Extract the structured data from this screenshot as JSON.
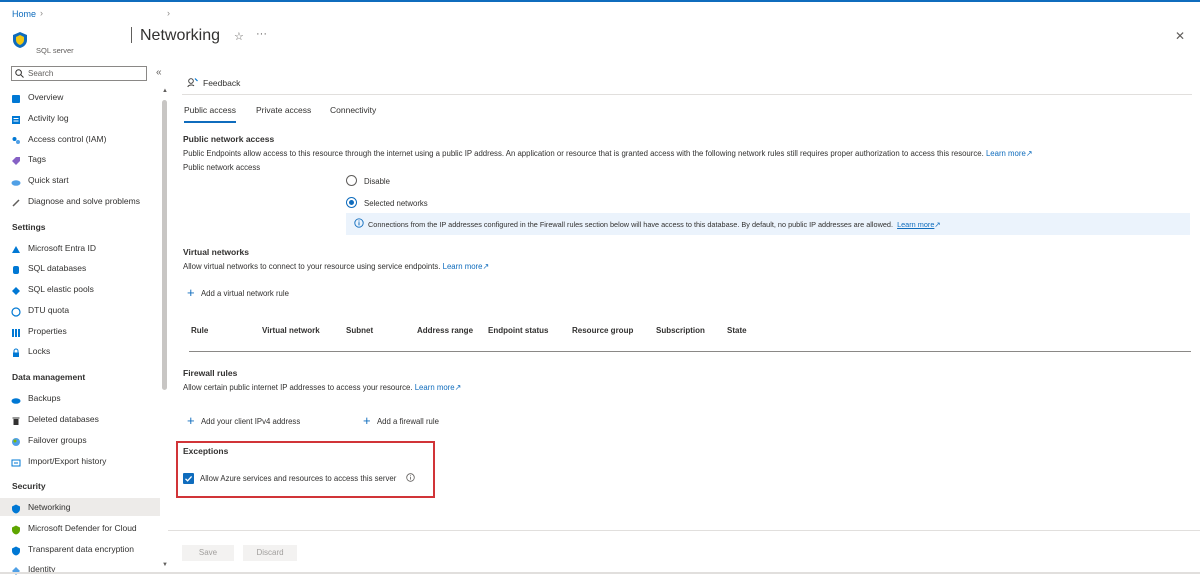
{
  "breadcrumb": {
    "home": "Home"
  },
  "header": {
    "title": "Networking",
    "resource_type": "SQL server"
  },
  "sidebar": {
    "search_placeholder": "Search",
    "top_items": [
      {
        "label": "Overview",
        "icon": "sql-database-icon"
      },
      {
        "label": "Activity log",
        "icon": "activity-log-icon"
      },
      {
        "label": "Access control (IAM)",
        "icon": "people-icon"
      },
      {
        "label": "Tags",
        "icon": "tag-icon"
      },
      {
        "label": "Quick start",
        "icon": "cloud-icon"
      },
      {
        "label": "Diagnose and solve problems",
        "icon": "wrench-icon"
      }
    ],
    "sections": [
      {
        "heading": "Settings",
        "items": [
          {
            "label": "Microsoft Entra ID",
            "icon": "entra-icon"
          },
          {
            "label": "SQL databases",
            "icon": "sql-database-icon"
          },
          {
            "label": "SQL elastic pools",
            "icon": "elastic-pool-icon"
          },
          {
            "label": "DTU quota",
            "icon": "quota-icon"
          },
          {
            "label": "Properties",
            "icon": "properties-icon"
          },
          {
            "label": "Locks",
            "icon": "lock-icon"
          }
        ]
      },
      {
        "heading": "Data management",
        "items": [
          {
            "label": "Backups",
            "icon": "backup-icon"
          },
          {
            "label": "Deleted databases",
            "icon": "trash-icon"
          },
          {
            "label": "Failover groups",
            "icon": "globe-icon"
          },
          {
            "label": "Import/Export history",
            "icon": "history-icon"
          }
        ]
      },
      {
        "heading": "Security",
        "items": [
          {
            "label": "Networking",
            "icon": "shield-icon",
            "active": true
          },
          {
            "label": "Microsoft Defender for Cloud",
            "icon": "defender-icon"
          },
          {
            "label": "Transparent data encryption",
            "icon": "shield-icon"
          },
          {
            "label": "Identity",
            "icon": "identity-icon"
          }
        ]
      }
    ]
  },
  "toolbar": {
    "feedback": "Feedback"
  },
  "tabs": [
    {
      "label": "Public access",
      "active": true
    },
    {
      "label": "Private access"
    },
    {
      "label": "Connectivity"
    }
  ],
  "public_network_access": {
    "title": "Public network access",
    "description": "Public Endpoints allow access to this resource through the internet using a public IP address. An application or resource that is granted access with the following network rules still requires proper authorization to access this resource.",
    "learn_more": "Learn more",
    "field_label": "Public network access",
    "options": [
      "Disable",
      "Selected networks"
    ],
    "selected": "Selected networks",
    "info_text": "Connections from the IP addresses configured in the Firewall rules section below will have access to this database. By default, no public IP addresses are allowed.",
    "info_learn_more": "Learn more"
  },
  "virtual_networks": {
    "title": "Virtual networks",
    "description": "Allow virtual networks to connect to your resource using service endpoints.",
    "learn_more": "Learn more",
    "add_rule": "Add a virtual network rule",
    "columns": [
      "Rule",
      "Virtual network",
      "Subnet",
      "Address range",
      "Endpoint status",
      "Resource group",
      "Subscription",
      "State"
    ]
  },
  "firewall_rules": {
    "title": "Firewall rules",
    "description": "Allow certain public internet IP addresses to access your resource.",
    "learn_more": "Learn more",
    "add_client_ip": "Add your client IPv4 address",
    "add_rule": "Add a firewall rule"
  },
  "exceptions": {
    "title": "Exceptions",
    "allow_azure_label": "Allow Azure services and resources to access this server",
    "allow_azure_checked": true
  },
  "footer": {
    "save": "Save",
    "discard": "Discard"
  },
  "colors": {
    "accent": "#0f6cbd",
    "highlight": "#d13438"
  }
}
